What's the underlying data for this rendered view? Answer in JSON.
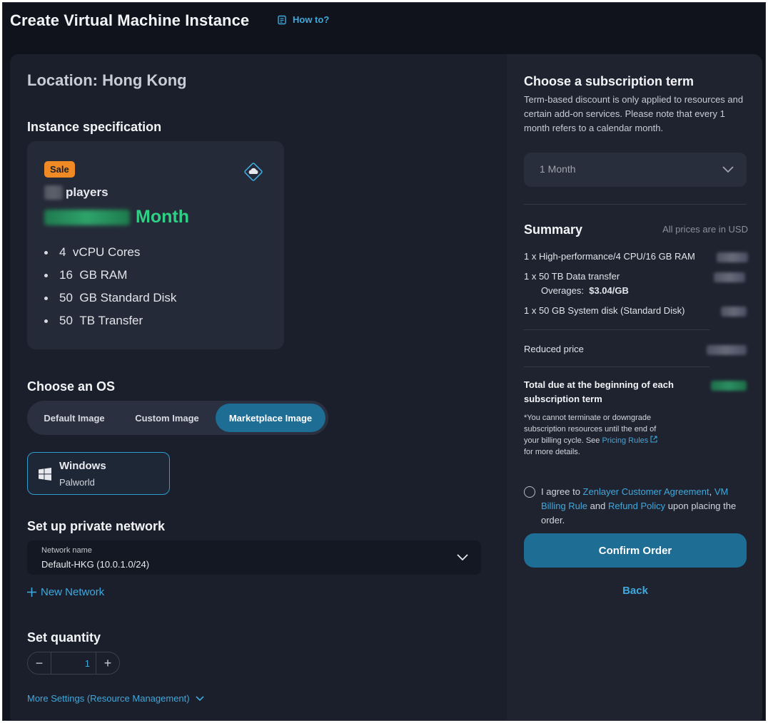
{
  "header": {
    "title": "Create Virtual Machine Instance",
    "howto_label": "How to?"
  },
  "config": {
    "location": "Location: Hong Kong",
    "spec_heading": "Instance specification",
    "sale_badge": "Sale",
    "plan_name": "players",
    "price_unit": "Month",
    "specs": [
      {
        "value": "4",
        "label": "vCPU Cores"
      },
      {
        "value": "16",
        "label": "GB  RAM"
      },
      {
        "value": "50",
        "label": "GB  Standard Disk"
      },
      {
        "value": "50",
        "label": "TB  Transfer"
      }
    ],
    "os_heading": "Choose an OS",
    "os_tabs": [
      "Default Image",
      "Custom Image",
      "Marketplace Image"
    ],
    "os_active_tab": "Marketplace Image",
    "os_selected": {
      "name": "Windows",
      "sub": "Palworld"
    },
    "network_heading": "Set up private network",
    "network_label": "Network name",
    "network_value": "Default-HKG (10.0.1.0/24)",
    "new_network": "New Network",
    "quantity_heading": "Set quantity",
    "quantity_minus": "−",
    "quantity_value": "1",
    "quantity_plus": "+",
    "more_settings": "More Settings (Resource Management)"
  },
  "sidebar": {
    "term_heading": "Choose a subscription term",
    "term_desc": "Term-based discount is only applied to resources and certain add-on services. Please note that every 1 month refers to a calendar month.",
    "term_value": "1 Month",
    "summary_heading": "Summary",
    "price_note": "All prices are in USD",
    "items": [
      "1 x High-performance/4 CPU/16 GB RAM",
      "1 x 50 TB Data transfer",
      "1 x 50 GB System disk (Standard Disk)"
    ],
    "overages_label": "Overages:",
    "overages_value": "$3.04/GB",
    "reduced_price": "Reduced price",
    "total_label": "Total due at the beginning of each subscription term",
    "fineprint_start": "*You cannot terminate or downgrade subscription resources until the end of your billing cycle. See ",
    "fineprint_link": "Pricing Rules",
    "fineprint_end": " for more details.",
    "agree_prefix": "I agree to ",
    "agree_link1": "Zenlayer Customer Agreement",
    "agree_sep": ", ",
    "agree_link2": "VM Billing Rule",
    "agree_and": " and ",
    "agree_link3": "Refund Policy",
    "agree_suffix": " upon placing the order.",
    "confirm_label": "Confirm Order",
    "back_label": "Back"
  },
  "colors": {
    "accent": "#3fa9dd",
    "primary_button": "#1d6d95",
    "price_green": "#2fcf86",
    "sale_orange": "#f08a24"
  }
}
